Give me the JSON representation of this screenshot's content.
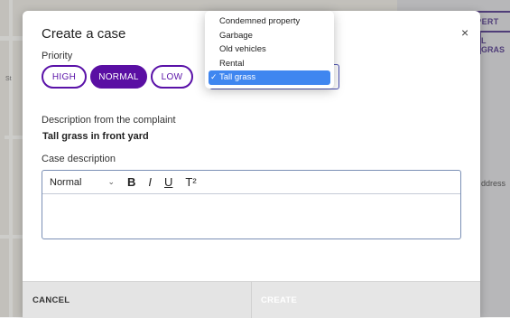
{
  "colors": {
    "accent": "#5a0fa3",
    "selected_option": "#3f86f0"
  },
  "background": {
    "right_pill_1": "OPERT",
    "right_pill_2": "L GRAS",
    "right_text": "ddress",
    "left_text": "St"
  },
  "modal": {
    "title": "Create a case",
    "close_icon": "×",
    "priority_label": "Priority",
    "priority_options": [
      "HIGH",
      "NORMAL",
      "LOW"
    ],
    "priority_selected": "NORMAL",
    "description_label": "Description from the complaint",
    "description_text": "Tall grass in front yard",
    "case_description_label": "Case description",
    "editor": {
      "format_select": "Normal",
      "bold": "B",
      "italic": "I",
      "underline": "U",
      "superscript": "T²"
    },
    "footer": {
      "cancel": "CANCEL",
      "create": "CREATE"
    }
  },
  "dropdown": {
    "options": [
      "Condemned property",
      "Garbage",
      "Old vehicles",
      "Rental",
      "Tall grass"
    ],
    "selected": "Tall grass",
    "check": "✓"
  }
}
